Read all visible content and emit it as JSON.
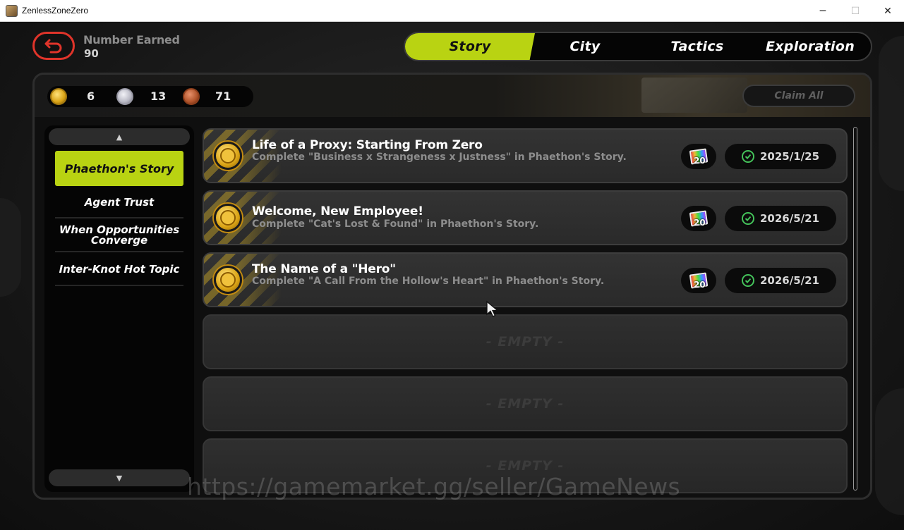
{
  "window": {
    "title": "ZenlessZoneZero",
    "minimize": "─",
    "maximize": "☐",
    "close": "✕"
  },
  "header": {
    "earned_label": "Number Earned",
    "earned_value": "90"
  },
  "tabs": [
    {
      "label": "Story",
      "active": true
    },
    {
      "label": "City",
      "active": false
    },
    {
      "label": "Tactics",
      "active": false
    },
    {
      "label": "Exploration",
      "active": false
    }
  ],
  "currency": [
    {
      "icon": "gold-medal-icon",
      "value": "6",
      "color": "#d9a315"
    },
    {
      "icon": "silver-medal-icon",
      "value": "13",
      "color": "#b8b8c4"
    },
    {
      "icon": "bronze-medal-icon",
      "value": "71",
      "color": "#b0532a"
    }
  ],
  "claim_all": "Claim All",
  "sidebar": {
    "scroll_up": "▲",
    "scroll_down": "▼",
    "items": [
      {
        "label": "Phaethon's Story",
        "active": true
      },
      {
        "label": "Agent Trust",
        "active": false
      },
      {
        "label": "When Opportunities Converge",
        "active": false
      },
      {
        "label": "Inter-Knot Hot Topic",
        "active": false
      }
    ]
  },
  "quests": [
    {
      "title": "Life of a Proxy: Starting From Zero",
      "description": "Complete \"Business x Strangeness x Justness\" in Phaethon's Story.",
      "reward_count": "20",
      "date": "2025/1/25"
    },
    {
      "title": "Welcome, New Employee!",
      "description": "Complete \"Cat's Lost & Found\" in Phaethon's Story.",
      "reward_count": "20",
      "date": "2026/5/21"
    },
    {
      "title": "The Name of a \"Hero\"",
      "description": "Complete \"A Call From the Hollow's Heart\" in Phaethon's Story.",
      "reward_count": "20",
      "date": "2026/5/21"
    }
  ],
  "empty_slots": [
    "- EMPTY -",
    "- EMPTY -",
    "- EMPTY -"
  ],
  "watermark": "https://gamemarket.gg/seller/GameNews",
  "colors": {
    "accent": "#b9d312",
    "back_button": "#e0342a",
    "check": "#44c25a"
  }
}
